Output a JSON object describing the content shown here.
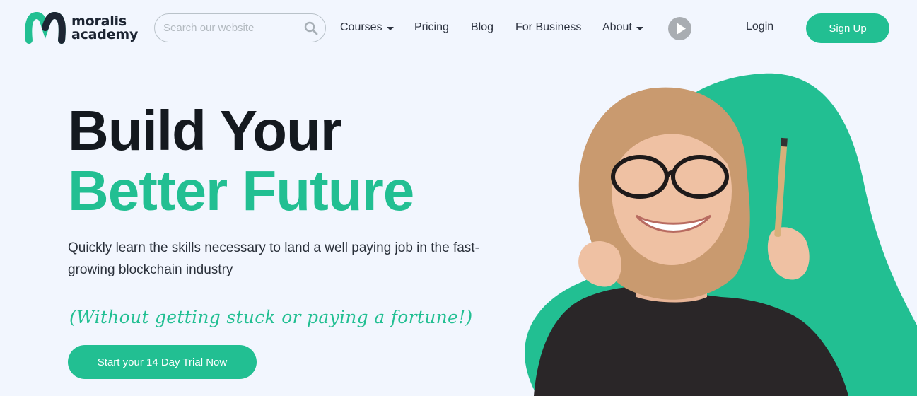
{
  "brand": {
    "name_line1": "moralis",
    "name_line2": "academy",
    "color": "#22bf92"
  },
  "search": {
    "placeholder": "Search our website",
    "value": ""
  },
  "nav": {
    "courses": "Courses",
    "pricing": "Pricing",
    "blog": "Blog",
    "for_business": "For Business",
    "about": "About",
    "login": "Login",
    "signup": "Sign Up"
  },
  "hero": {
    "headline_line1": "Build Your",
    "headline_line2": "Better Future",
    "subtitle": "Quickly learn the skills necessary to land a well paying job in the fast-growing blockchain industry",
    "tagline": "(Without getting stuck or paying a fortune!)",
    "cta": "Start your 14 Day Trial Now"
  },
  "icons": {
    "search": "search-icon",
    "play": "play-icon",
    "dropdown": "chevron-down-icon"
  },
  "colors": {
    "accent": "#22bf92",
    "background": "#f2f6fe",
    "text": "#14191f"
  }
}
